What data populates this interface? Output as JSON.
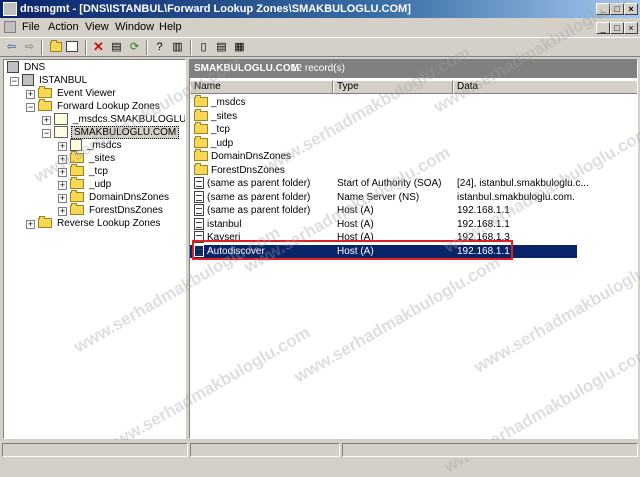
{
  "window": {
    "title": "dnsmgmt - [DNS\\ISTANBUL\\Forward Lookup Zones\\SMAKBULOGLU.COM]",
    "minimize": "_",
    "restore": "□",
    "close": "×"
  },
  "menu": {
    "items": [
      "File",
      "Action",
      "View",
      "Window",
      "Help"
    ]
  },
  "toolbar": {
    "icons": [
      "back-icon",
      "forward-icon",
      "up-folder-icon",
      "show-tree-icon",
      "delete-icon",
      "properties-icon",
      "refresh-icon",
      "help-icon",
      "console-icon",
      "server-icon",
      "list-icon",
      "export-icon"
    ]
  },
  "tree": {
    "root": "DNS",
    "server": "ISTANBUL",
    "event_viewer": "Event Viewer",
    "forward_zones": "Forward Lookup Zones",
    "msdcs_zone": "_msdcs.SMAKBULOGLU.COM",
    "zone": "SMAKBULOGLU.COM",
    "zone_children": [
      "_msdcs",
      "_sites",
      "_tcp",
      "_udp",
      "DomainDnsZones",
      "ForestDnsZones"
    ],
    "reverse_zones": "Reverse Lookup Zones"
  },
  "panel": {
    "title": "SMAKBULOGLU.COM",
    "count": "12 record(s)",
    "columns": [
      "Name",
      "Type",
      "Data"
    ],
    "rows": [
      {
        "name": "_msdcs",
        "type": "",
        "data": "",
        "kind": "folder"
      },
      {
        "name": "_sites",
        "type": "",
        "data": "",
        "kind": "folder"
      },
      {
        "name": "_tcp",
        "type": "",
        "data": "",
        "kind": "folder"
      },
      {
        "name": "_udp",
        "type": "",
        "data": "",
        "kind": "folder"
      },
      {
        "name": "DomainDnsZones",
        "type": "",
        "data": "",
        "kind": "folder"
      },
      {
        "name": "ForestDnsZones",
        "type": "",
        "data": "",
        "kind": "folder"
      },
      {
        "name": "(same as parent folder)",
        "type": "Start of Authority (SOA)",
        "data": "[24], istanbul.smakbuloglu.c...",
        "kind": "record"
      },
      {
        "name": "(same as parent folder)",
        "type": "Name Server (NS)",
        "data": "istanbul.smakbuloglu.com.",
        "kind": "record"
      },
      {
        "name": "(same as parent folder)",
        "type": "Host (A)",
        "data": "192.168.1.1",
        "kind": "record"
      },
      {
        "name": "istanbul",
        "type": "Host (A)",
        "data": "192.168.1.1",
        "kind": "record"
      },
      {
        "name": "Kayseri",
        "type": "Host (A)",
        "data": "192.168.1.3",
        "kind": "record"
      },
      {
        "name": "Autodiscover",
        "type": "Host (A)",
        "data": "192.168.1.1",
        "kind": "record",
        "selected": true
      }
    ]
  },
  "watermark": "www.serhadmakbuloglu.com",
  "colors": {
    "title_active": "#0a246a",
    "selection": "#0a246a",
    "highlight_border": "#e02020",
    "panel_header": "#808080"
  }
}
